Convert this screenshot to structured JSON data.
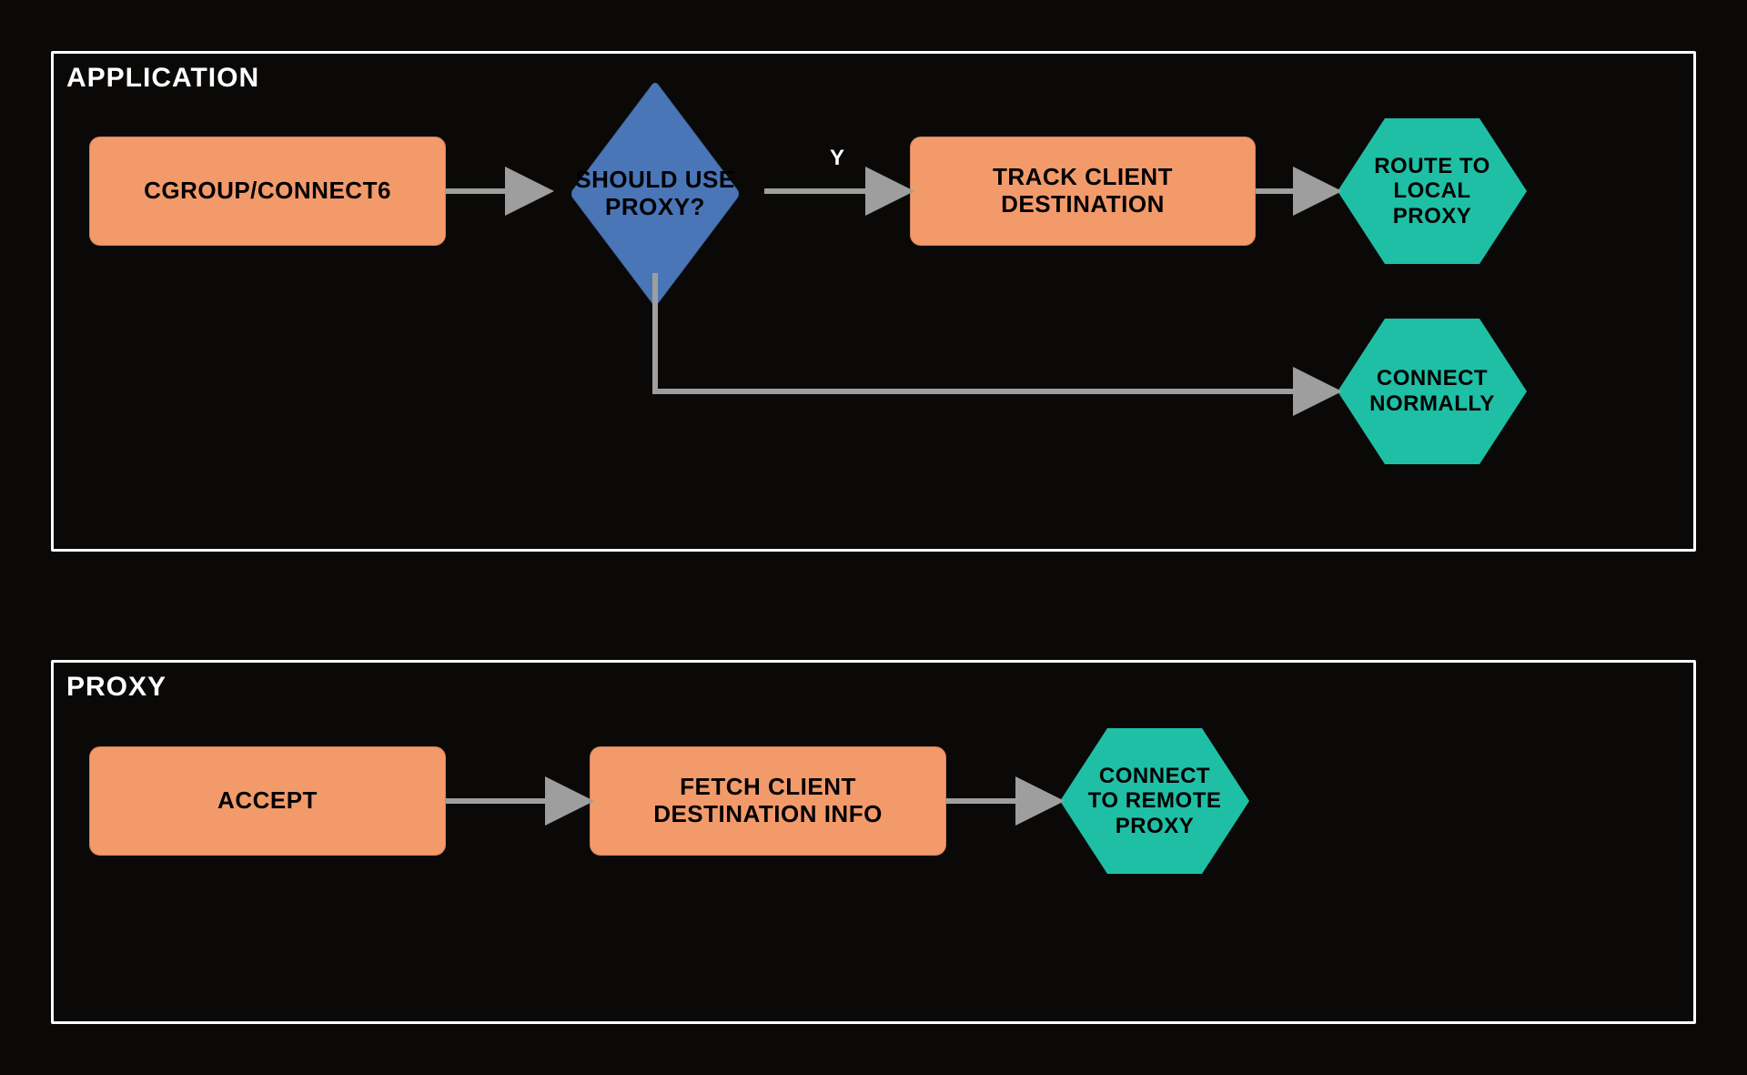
{
  "colors": {
    "background": "#0a0908",
    "panel_border": "#ffffff",
    "process": "#f39a6b",
    "decision": "#4a76b8",
    "terminal": "#1fbfa6",
    "arrow": "#9e9e9e"
  },
  "panels": {
    "application": {
      "title": "APPLICATION",
      "nodes": {
        "cgroup": {
          "type": "process",
          "label": "CGROUP/CONNECT6"
        },
        "decision": {
          "type": "decision",
          "label": "SHOULD USE\nPROXY?"
        },
        "track": {
          "type": "process",
          "label": "TRACK CLIENT\nDESTINATION"
        },
        "route": {
          "type": "terminal",
          "label": "ROUTE TO\nLOCAL\nPROXY"
        },
        "connect": {
          "type": "terminal",
          "label": "CONNECT\nNORMALLY"
        }
      },
      "edges": [
        {
          "from": "cgroup",
          "to": "decision",
          "label": ""
        },
        {
          "from": "decision",
          "to": "track",
          "label": "Y"
        },
        {
          "from": "track",
          "to": "route",
          "label": ""
        },
        {
          "from": "decision",
          "to": "connect",
          "label": ""
        }
      ]
    },
    "proxy": {
      "title": "PROXY",
      "nodes": {
        "accept": {
          "type": "process",
          "label": "ACCEPT"
        },
        "fetch": {
          "type": "process",
          "label": "FETCH CLIENT\nDESTINATION INFO"
        },
        "remote": {
          "type": "terminal",
          "label": "CONNECT\nTO REMOTE\nPROXY"
        }
      },
      "edges": [
        {
          "from": "accept",
          "to": "fetch",
          "label": ""
        },
        {
          "from": "fetch",
          "to": "remote",
          "label": ""
        }
      ]
    }
  }
}
